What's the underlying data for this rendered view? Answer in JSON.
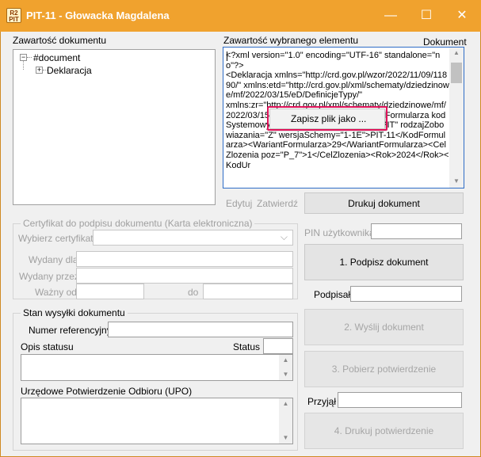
{
  "window": {
    "title": "PIT-11 - Głowacka Magdalena",
    "logo_text": "R2\nPIT",
    "minimize_glyph": "—",
    "maximize_glyph": "☐",
    "close_glyph": "✕"
  },
  "left": {
    "doc_content_label": "Zawartość dokumentu",
    "tree": {
      "root_expander": "−",
      "root_label": "#document",
      "child_expander": "+",
      "child_label": "Deklaracja"
    }
  },
  "right": {
    "element_content_label": "Zawartość wybranego elementu",
    "document_label": "Dokument",
    "xml_text": "<?xml version=\"1.0\" encoding=\"UTF-16\" standalone=\"no\"?>\n<Deklaracja xmlns=\"http://crd.gov.pl/wzor/2022/11/09/11890/\" xmlns:etd=\"http://crd.gov.pl/xml/schematy/dziedzinowe/mf/2022/03/15/eD/DefinicjeTypy/\"\nxmlns:zr=\"http://crd.gov.pl/xml/schematy/dziedzinowe/mf/2022/03/15/eD/PITR/\"><Naglowek><KodFormularza kodSystemowy=\"PIT-11 (29)\" kodPodatku=\"PIT\" rodzajZobowiazania=\"Z\" wersjaSchemy=\"1-1E\">PIT-11</KodFormularza><WariantFormularza>29</WariantFormularza><CelZlozenia poz=\"P_7\">1</CelZlozenia><Rok>2024</Rok><KodUr",
    "context_menu_item": "Zapisz plik jako ...",
    "edit_button": "Edytuj",
    "confirm_button": "Zatwierdź",
    "print_document_button": "Drukuj dokument",
    "pin_label": "PIN użytkownika",
    "pin_value": "",
    "sign_button": "1. Podpisz dokument",
    "signed_label": "Podpisał",
    "signed_value": "",
    "send_button": "2. Wyślij dokument",
    "fetch_button": "3. Pobierz potwierdzenie",
    "accepted_label": "Przyjął",
    "accepted_value": "",
    "print_confirmation_button": "4. Drukuj potwierdzenie"
  },
  "certificate": {
    "group_label": "Certyfikat do podpisu dokumentu  (Karta elektroniczna)",
    "choose_label": "Wybierz certyfikat",
    "choose_value": "",
    "issued_for_label": "Wydany dla",
    "issued_for_value": "",
    "issued_by_label": "Wydany przez",
    "issued_by_value": "",
    "valid_from_label": "Ważny od",
    "valid_from_value": "",
    "to_label": "do",
    "valid_to_value": ""
  },
  "status": {
    "group_label": "Stan wysyłki dokumentu",
    "ref_number_label": "Numer referencyjny",
    "ref_number_value": "",
    "status_desc_label": "Opis statusu",
    "status_label": "Status",
    "status_value": "",
    "status_desc_value": "",
    "upo_label": "Urzędowe Potwierdzenie Odbioru (UPO)",
    "upo_value": ""
  }
}
